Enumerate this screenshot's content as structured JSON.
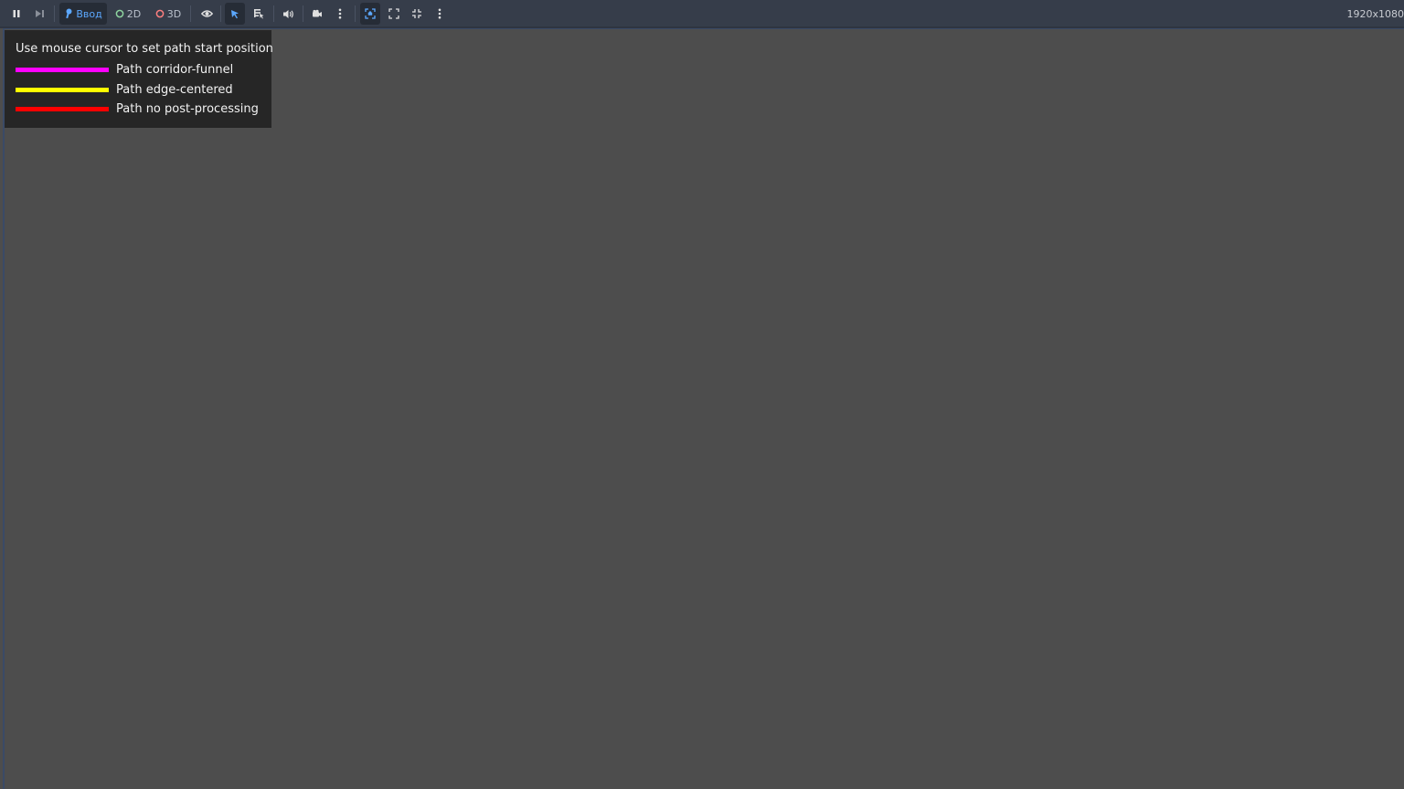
{
  "toolbar": {
    "mode_input_label": "Ввод",
    "mode_2d_label": "2D",
    "mode_3d_label": "3D",
    "resolution": "1920x1080",
    "icons": {
      "pause": "pause-icon",
      "next_frame": "next-frame-icon",
      "input": "joystick-icon",
      "visibility": "eye-icon",
      "select": "cursor-arrow-icon",
      "list_select": "list-select-icon",
      "audio": "speaker-icon",
      "camera": "camera-icon",
      "more": "kebab-menu-icon",
      "focus": "focus-frame-icon",
      "fullscreen": "expand-icon",
      "shrink": "shrink-icon"
    },
    "colors": {
      "accent": "#5ca8ff",
      "mode_2d_circle": "#8ed49f",
      "mode_3d_circle": "#fc7f7f"
    }
  },
  "legend": {
    "title": "Use mouse cursor to set path start position",
    "items": [
      {
        "label": "Path corridor-funnel",
        "color": "#ff00ff"
      },
      {
        "label": "Path edge-centered",
        "color": "#ffff00"
      },
      {
        "label": "Path no post-processing",
        "color": "#ff0000"
      }
    ]
  }
}
